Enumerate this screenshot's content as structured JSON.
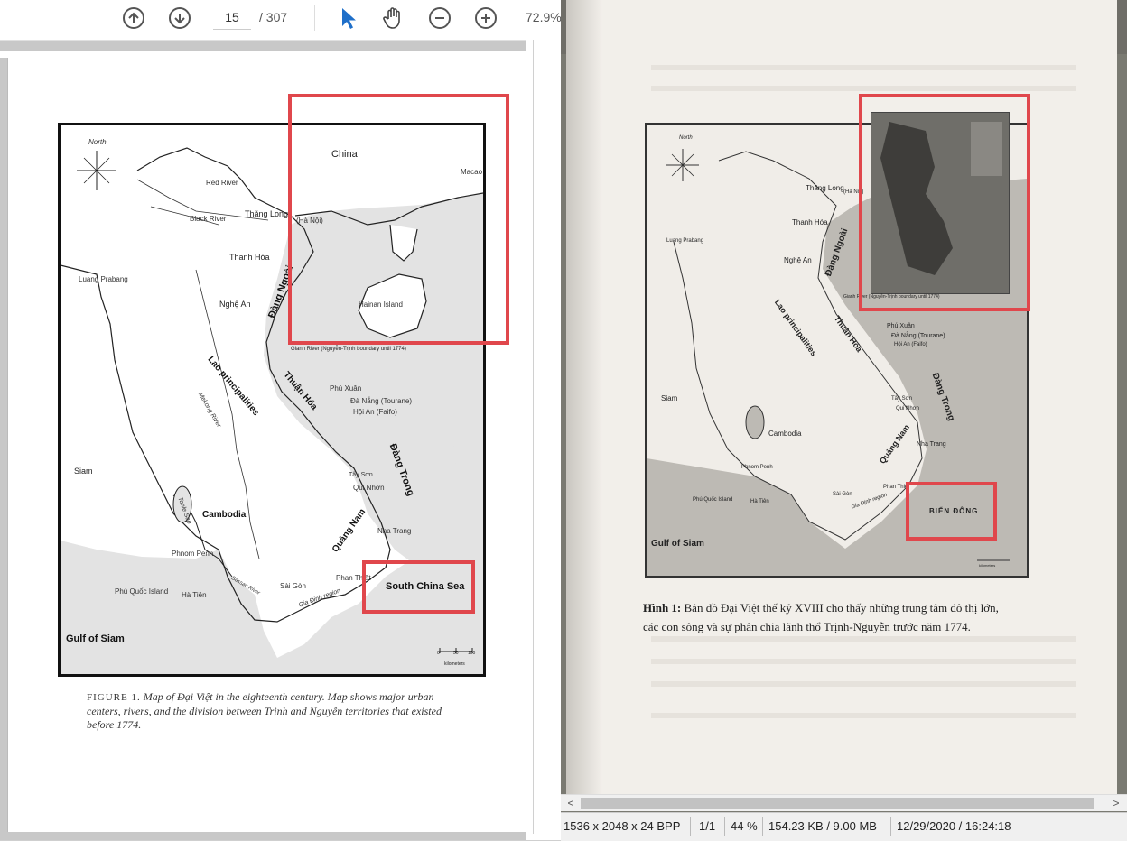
{
  "pdf_viewer": {
    "toolbar": {
      "prev_page_icon": "arrow-up-circle-icon",
      "next_page_icon": "arrow-down-circle-icon",
      "current_page": "15",
      "page_total": "/ 307",
      "select_tool_icon": "cursor-arrow-icon",
      "hand_tool_icon": "hand-icon",
      "zoom_out_icon": "minus-circle-icon",
      "zoom_in_icon": "plus-circle-icon",
      "zoom": "72.9%"
    },
    "map": {
      "compass": "North",
      "labels": {
        "china": "China",
        "macao": "Macao",
        "red_river": "Red River",
        "black_river": "Black River",
        "thang_long": "Thăng Long",
        "ha_noi": "(Hà Nội)",
        "thanh_hoa": "Thanh Hóa",
        "luang_prabang": "Luang Prabang",
        "nghe_an": "Nghệ An",
        "dang_ngoai": "Đàng Ngoài",
        "hainan": "Hainan Island",
        "gianh_river": "Gianh River (Nguyễn-Trịnh boundary until 1774)",
        "lao": "Lao principalities",
        "mekong": "Mekong River",
        "thuan_hoa": "Thuận Hóa",
        "phu_xuan": "Phú Xuân",
        "da_nang": "Đà Nẵng (Tourane)",
        "hoi_an": "Hội An (Faifo)",
        "siam": "Siam",
        "tay_son": "Tây Sơn",
        "qui_nhon": "Qui Nhơn",
        "dang_trong": "Đàng Trong",
        "tonle_sap": "Tonle Sap",
        "cambodia": "Cambodia",
        "quang_nam": "Quảng Nam",
        "nha_trang": "Nha Trang",
        "phnom_penh": "Phnom Penh",
        "phan_thiet": "Phan Thiết",
        "phu_quoc": "Phú Quốc Island",
        "ha_tien": "Hà Tiên",
        "bassac": "Bassac River",
        "sai_gon": "Sài Gòn",
        "gia_dinh": "Gia Định region",
        "south_china_sea": "South China Sea",
        "gulf_of_siam": "Gulf of Siam",
        "scale_0": "0",
        "scale_50": "50",
        "scale_100": "100",
        "kilometers": "kilometers"
      }
    },
    "caption_fig": "FIGURE 1.",
    "caption_text": "Map of Đại Việt in the eighteenth century. Map shows major urban centers, rivers, and the division between Trịnh and Nguyễn territories that existed before 1774."
  },
  "photo_viewer": {
    "map": {
      "labels": {
        "north": "North",
        "thang_long": "Thăng Long",
        "ha_noi": "(Hà Nội)",
        "thanh_hoa": "Thanh Hóa",
        "luang_prabang": "Luang Prabang",
        "nghe_an": "Nghệ An",
        "dang_ngoai": "Đàng Ngoài",
        "gianh": "Gianh River (Nguyễn-Trịnh boundary until 1774)",
        "lao": "Lao principalities",
        "thuan_hoa": "Thuận Hóa",
        "phu_xuan": "Phú Xuân",
        "da_nang": "Đà Nẵng (Tourane)",
        "hoi_an": "Hội An (Faifo)",
        "dang_trong": "Đàng Trong",
        "siam": "Siam",
        "tay_son": "Tây Sơn",
        "qui_nhon": "Qui Nhơn",
        "cambodia": "Cambodia",
        "quang_nam": "Quảng Nam",
        "nha_trang": "Nha Trang",
        "phnom_penh": "Phnom Penh",
        "phu_quoc": "Phú Quốc Island",
        "ha_tien": "Hà Tiên",
        "sai_gon": "Sài Gòn",
        "phan_thiet": "Phan Thiết",
        "gia_dinh": "Gia Định region",
        "bien_dong": "BIỂN ĐÔNG",
        "gulf_of_siam": "Gulf of Siam",
        "kilometers": "kilometers"
      }
    },
    "caption_bold": "Hình 1:",
    "caption_line1": " Bản đồ Đại Việt thế kỷ XVIII cho thấy những trung tâm đô thị lớn,",
    "caption_line2": "các con sông và sự phân chia lãnh thổ Trịnh-Nguyễn trước năm 1774."
  },
  "scrollbar": {
    "left_arrow": "<",
    "right_arrow": ">"
  },
  "status_bar": {
    "dimensions": "1536 x 2048 x 24 BPP",
    "page": "1/1",
    "zoom": "44 %",
    "size": "154.23 KB / 9.00 MB",
    "datetime": "12/29/2020 / 16:24:18"
  },
  "colors": {
    "highlight_red": "#e0474c",
    "sea_gray": "#e3e3e3"
  }
}
